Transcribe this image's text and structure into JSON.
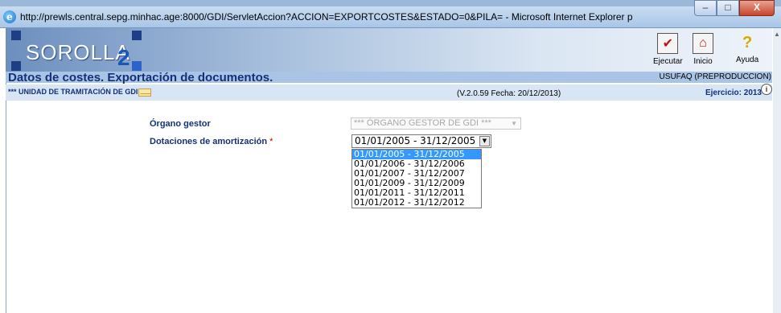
{
  "window": {
    "ie_icon": "e",
    "title": "http://prewls.central.sepg.minhac.age:8000/GDI/ServletAccion?ACCION=EXPORTCOSTES&ESTADO=0&PILA= - Microsoft Internet Explorer p",
    "min_label": "–",
    "max_label": "□",
    "close_label": "X"
  },
  "app": {
    "logo_text": "SOROLLA",
    "logo_number": "2",
    "toolbar": {
      "ejecutar_label": "Ejecutar",
      "inicio_label": "Inicio",
      "ayuda_label": "Ayuda",
      "ejecutar_icon": "✔",
      "inicio_icon": "⌂",
      "ayuda_icon": "?"
    },
    "page_title": "Datos de costes. Exportación de documentos.",
    "user_info": "USUFAQ (PREPRODUCCION)",
    "unit_label": "*** UNIDAD DE TRAMITACIÓN DE GDI ***",
    "version": "(V.2.0.59 Fecha: 20/12/2013)",
    "ejercicio": "Ejercicio: 2013",
    "info_icon": "i"
  },
  "form": {
    "organo_label": "Órgano gestor",
    "organo_value": "*** ÓRGANO GESTOR DE GDI ***",
    "dotaciones_label": "Dotaciones de amortización",
    "required_mark": "*",
    "dotaciones_value": "01/01/2005 - 31/12/2005",
    "options": [
      "01/01/2005 - 31/12/2005",
      "01/01/2006 - 31/12/2006",
      "01/01/2007 - 31/12/2007",
      "01/01/2009 - 31/12/2009",
      "01/01/2011 - 31/12/2011",
      "01/01/2012 - 31/12/2012"
    ],
    "selected_index": 0
  }
}
